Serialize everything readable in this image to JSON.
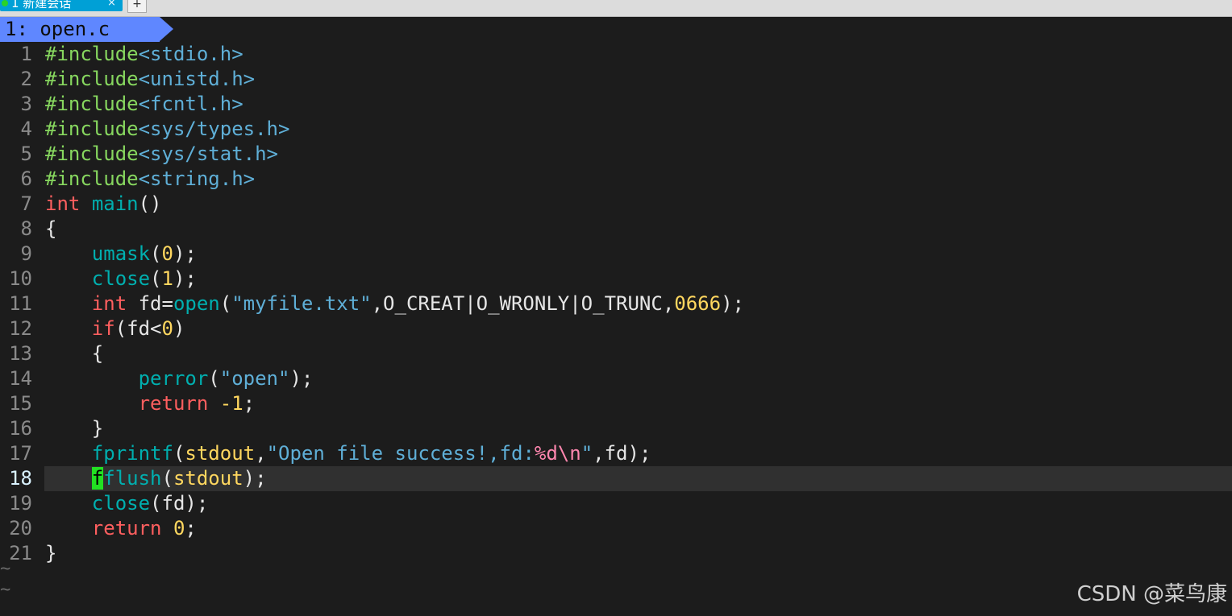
{
  "window": {
    "tab_title": "1 新建会话",
    "tab_close": "×",
    "tab_add": "+"
  },
  "buffer": {
    "label": "1: open.c"
  },
  "editor": {
    "cursor_line": 18,
    "tilde": "~",
    "lines": [
      {
        "num": "1",
        "tokens": [
          {
            "t": "#include",
            "c": "pp"
          },
          {
            "t": "<stdio.h>",
            "c": "inc"
          }
        ]
      },
      {
        "num": "2",
        "tokens": [
          {
            "t": "#include",
            "c": "pp"
          },
          {
            "t": "<unistd.h>",
            "c": "inc"
          }
        ]
      },
      {
        "num": "3",
        "tokens": [
          {
            "t": "#include",
            "c": "pp"
          },
          {
            "t": "<fcntl.h>",
            "c": "inc"
          }
        ]
      },
      {
        "num": "4",
        "tokens": [
          {
            "t": "#include",
            "c": "pp"
          },
          {
            "t": "<sys/types.h>",
            "c": "inc"
          }
        ]
      },
      {
        "num": "5",
        "tokens": [
          {
            "t": "#include",
            "c": "pp"
          },
          {
            "t": "<sys/stat.h>",
            "c": "inc"
          }
        ]
      },
      {
        "num": "6",
        "tokens": [
          {
            "t": "#include",
            "c": "pp"
          },
          {
            "t": "<string.h>",
            "c": "inc"
          }
        ]
      },
      {
        "num": "7",
        "tokens": [
          {
            "t": "int",
            "c": "kw"
          },
          {
            "t": " ",
            "c": "plain"
          },
          {
            "t": "main",
            "c": "fn"
          },
          {
            "t": "()",
            "c": "sym"
          }
        ]
      },
      {
        "num": "8",
        "tokens": [
          {
            "t": "{",
            "c": "sym"
          }
        ]
      },
      {
        "num": "9",
        "tokens": [
          {
            "t": "    ",
            "c": "plain"
          },
          {
            "t": "umask",
            "c": "fn"
          },
          {
            "t": "(",
            "c": "sym"
          },
          {
            "t": "0",
            "c": "num"
          },
          {
            "t": ");",
            "c": "sym"
          }
        ]
      },
      {
        "num": "10",
        "tokens": [
          {
            "t": "    ",
            "c": "plain"
          },
          {
            "t": "close",
            "c": "fn"
          },
          {
            "t": "(",
            "c": "sym"
          },
          {
            "t": "1",
            "c": "num"
          },
          {
            "t": ");",
            "c": "sym"
          }
        ]
      },
      {
        "num": "11",
        "tokens": [
          {
            "t": "    ",
            "c": "plain"
          },
          {
            "t": "int",
            "c": "kw"
          },
          {
            "t": " fd=",
            "c": "plain"
          },
          {
            "t": "open",
            "c": "fn"
          },
          {
            "t": "(",
            "c": "sym"
          },
          {
            "t": "\"myfile.txt\"",
            "c": "str"
          },
          {
            "t": ",O_CREAT|O_WRONLY|O_TRUNC,",
            "c": "plain"
          },
          {
            "t": "0666",
            "c": "num"
          },
          {
            "t": ");",
            "c": "sym"
          }
        ]
      },
      {
        "num": "12",
        "tokens": [
          {
            "t": "    ",
            "c": "plain"
          },
          {
            "t": "if",
            "c": "kw"
          },
          {
            "t": "(fd<",
            "c": "sym"
          },
          {
            "t": "0",
            "c": "num"
          },
          {
            "t": ")",
            "c": "sym"
          }
        ]
      },
      {
        "num": "13",
        "tokens": [
          {
            "t": "    {",
            "c": "sym"
          }
        ]
      },
      {
        "num": "14",
        "tokens": [
          {
            "t": "        ",
            "c": "plain"
          },
          {
            "t": "perror",
            "c": "fn"
          },
          {
            "t": "(",
            "c": "sym"
          },
          {
            "t": "\"open\"",
            "c": "str"
          },
          {
            "t": ");",
            "c": "sym"
          }
        ]
      },
      {
        "num": "15",
        "tokens": [
          {
            "t": "        ",
            "c": "plain"
          },
          {
            "t": "return",
            "c": "kw"
          },
          {
            "t": " ",
            "c": "plain"
          },
          {
            "t": "-1",
            "c": "num"
          },
          {
            "t": ";",
            "c": "sym"
          }
        ]
      },
      {
        "num": "16",
        "tokens": [
          {
            "t": "    }",
            "c": "sym"
          }
        ]
      },
      {
        "num": "17",
        "tokens": [
          {
            "t": "    ",
            "c": "plain"
          },
          {
            "t": "fprintf",
            "c": "fn"
          },
          {
            "t": "(",
            "c": "sym"
          },
          {
            "t": "stdout",
            "c": "num"
          },
          {
            "t": ",",
            "c": "sym"
          },
          {
            "t": "\"Open file success!,fd:",
            "c": "str"
          },
          {
            "t": "%d\\n",
            "c": "esc"
          },
          {
            "t": "\"",
            "c": "str"
          },
          {
            "t": ",fd);",
            "c": "sym"
          }
        ]
      },
      {
        "num": "18",
        "tokens": [
          {
            "t": "    ",
            "c": "plain"
          },
          {
            "t": "f",
            "c": "cursor"
          },
          {
            "t": "flush",
            "c": "fn"
          },
          {
            "t": "(",
            "c": "sym"
          },
          {
            "t": "stdout",
            "c": "num"
          },
          {
            "t": ");",
            "c": "sym"
          }
        ]
      },
      {
        "num": "19",
        "tokens": [
          {
            "t": "    ",
            "c": "plain"
          },
          {
            "t": "close",
            "c": "fn"
          },
          {
            "t": "(fd);",
            "c": "sym"
          }
        ]
      },
      {
        "num": "20",
        "tokens": [
          {
            "t": "    ",
            "c": "plain"
          },
          {
            "t": "return",
            "c": "kw"
          },
          {
            "t": " ",
            "c": "plain"
          },
          {
            "t": "0",
            "c": "num"
          },
          {
            "t": ";",
            "c": "sym"
          }
        ]
      },
      {
        "num": "21",
        "tokens": [
          {
            "t": "}",
            "c": "sym"
          }
        ]
      }
    ]
  },
  "watermark": "CSDN @菜鸟康",
  "colors": {
    "background": "#1c1c1c",
    "buffer_tab": "#5f87ff",
    "preprocessor": "#87d75f",
    "include_path": "#5fafd7",
    "keyword": "#ff5f5f",
    "function": "#00afaf",
    "number": "#ffd75f",
    "string": "#5fafd7",
    "escape": "#ff87af",
    "cursor": "#22e122",
    "cursorline": "#303030"
  }
}
